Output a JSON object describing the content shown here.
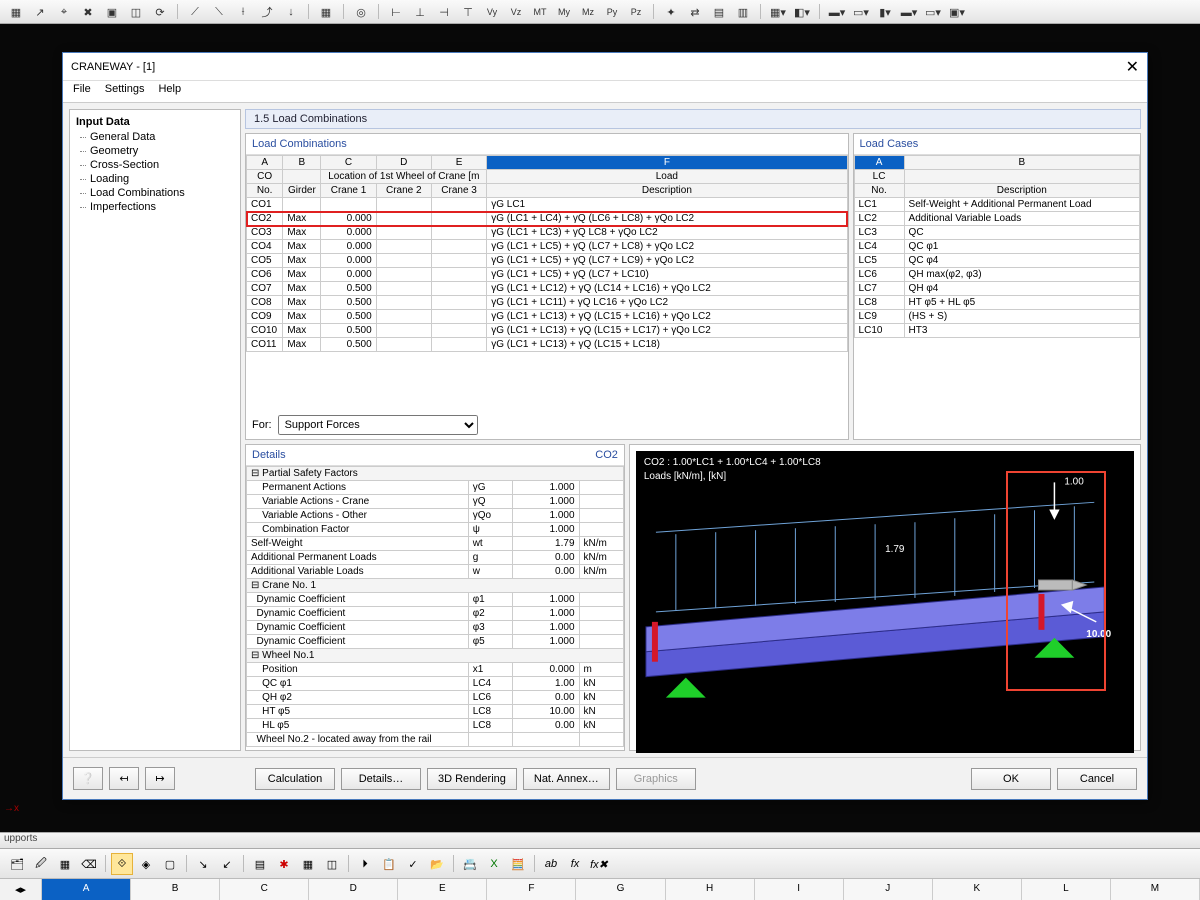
{
  "window_title": "CRANEWAY - [1]",
  "menu": [
    "File",
    "Settings",
    "Help"
  ],
  "section_title": "1.5 Load Combinations",
  "tree_root": "Input Data",
  "tree": [
    "General Data",
    "Geometry",
    "Cross-Section",
    "Loading",
    "Load Combinations",
    "Imperfections"
  ],
  "lc_panel_title": "Load Combinations",
  "lc_cols_top": [
    "A",
    "B",
    "C",
    "D",
    "E",
    "F"
  ],
  "lc_head1": {
    "a": "CO",
    "b": "",
    "c": "Location of 1st Wheel of Crane [m",
    "d": "Load"
  },
  "lc_head2": {
    "a": "No.",
    "b": "Girder",
    "c": "Crane 1",
    "d": "Crane 2",
    "e": "Crane 3",
    "f": "Description"
  },
  "lc_rows": [
    {
      "no": "CO1",
      "g": "",
      "c1": "",
      "desc": "γG LC1"
    },
    {
      "no": "CO2",
      "g": "Max",
      "c1": "0.000",
      "desc": "γG (LC1 + LC4) + γQ (LC6 + LC8) + γQo LC2",
      "hl": true
    },
    {
      "no": "CO3",
      "g": "Max",
      "c1": "0.000",
      "desc": "γG (LC1 + LC3) + γQ LC8 + γQo LC2"
    },
    {
      "no": "CO4",
      "g": "Max",
      "c1": "0.000",
      "desc": "γG (LC1 + LC5) + γQ (LC7 + LC8) + γQo LC2"
    },
    {
      "no": "CO5",
      "g": "Max",
      "c1": "0.000",
      "desc": "γG (LC1 + LC5) + γQ (LC7 + LC9) + γQo LC2"
    },
    {
      "no": "CO6",
      "g": "Max",
      "c1": "0.000",
      "desc": "γG (LC1 + LC5) + γQ (LC7 + LC10)"
    },
    {
      "no": "CO7",
      "g": "Max",
      "c1": "0.500",
      "desc": "γG (LC1 + LC12) + γQ (LC14 + LC16) + γQo LC2"
    },
    {
      "no": "CO8",
      "g": "Max",
      "c1": "0.500",
      "desc": "γG (LC1 + LC11) + γQ LC16 + γQo LC2"
    },
    {
      "no": "CO9",
      "g": "Max",
      "c1": "0.500",
      "desc": "γG (LC1 + LC13) + γQ (LC15 + LC16) + γQo LC2"
    },
    {
      "no": "CO10",
      "g": "Max",
      "c1": "0.500",
      "desc": "γG (LC1 + LC13) + γQ (LC15 + LC17) + γQo LC2"
    },
    {
      "no": "CO11",
      "g": "Max",
      "c1": "0.500",
      "desc": "γG (LC1 + LC13) + γQ (LC15 + LC18)"
    }
  ],
  "for_label": "For:",
  "for_value": "Support Forces",
  "cases_title": "Load Cases",
  "cases_cols": [
    "A",
    "B"
  ],
  "cases_head": {
    "a": "LC",
    "b": ""
  },
  "cases_head2": {
    "a": "No.",
    "b": "Description"
  },
  "cases": [
    {
      "n": "LC1",
      "d": "Self-Weight + Additional Permanent Load"
    },
    {
      "n": "LC2",
      "d": "Additional Variable Loads"
    },
    {
      "n": "LC3",
      "d": "QC"
    },
    {
      "n": "LC4",
      "d": "QC φ1"
    },
    {
      "n": "LC5",
      "d": "QC φ4"
    },
    {
      "n": "LC6",
      "d": "QH max(φ2, φ3)"
    },
    {
      "n": "LC7",
      "d": "QH φ4"
    },
    {
      "n": "LC8",
      "d": "HT φ5 + HL φ5"
    },
    {
      "n": "LC9",
      "d": "(HS + S)"
    },
    {
      "n": "LC10",
      "d": "HT3"
    }
  ],
  "details_title": "Details",
  "details_tag": "CO2",
  "details": [
    {
      "g": "Partial Safety Factors",
      "grp": true
    },
    {
      "l": "    Permanent Actions",
      "s": "γG",
      "v": "1.000",
      "u": ""
    },
    {
      "l": "    Variable Actions - Crane",
      "s": "γQ",
      "v": "1.000",
      "u": ""
    },
    {
      "l": "    Variable Actions - Other",
      "s": "γQo",
      "v": "1.000",
      "u": ""
    },
    {
      "l": "    Combination Factor",
      "s": "ψ",
      "v": "1.000",
      "u": ""
    },
    {
      "l": "Self-Weight",
      "s": "wt",
      "v": "1.79",
      "u": "kN/m"
    },
    {
      "l": "Additional Permanent Loads",
      "s": "g",
      "v": "0.00",
      "u": "kN/m"
    },
    {
      "l": "Additional Variable Loads",
      "s": "w",
      "v": "0.00",
      "u": "kN/m"
    },
    {
      "g": "Crane No. 1",
      "grp": true
    },
    {
      "l": "  Dynamic Coefficient",
      "s": "φ1",
      "v": "1.000",
      "u": ""
    },
    {
      "l": "  Dynamic Coefficient",
      "s": "φ2",
      "v": "1.000",
      "u": ""
    },
    {
      "l": "  Dynamic Coefficient",
      "s": "φ3",
      "v": "1.000",
      "u": ""
    },
    {
      "l": "  Dynamic Coefficient",
      "s": "φ5",
      "v": "1.000",
      "u": ""
    },
    {
      "g": "  Wheel No.1",
      "grp": true
    },
    {
      "l": "    Position",
      "s": "x1",
      "v": "0.000",
      "u": "m"
    },
    {
      "l": "    QC φ1",
      "s": "LC4",
      "v": "1.00",
      "u": "kN"
    },
    {
      "l": "    QH φ2",
      "s": "LC6",
      "v": "0.00",
      "u": "kN"
    },
    {
      "l": "    HT φ5",
      "s": "LC8",
      "v": "10.00",
      "u": "kN"
    },
    {
      "l": "    HL φ5",
      "s": "LC8",
      "v": "0.00",
      "u": "kN"
    },
    {
      "l": "  Wheel No.2 - located away from the rail",
      "s": "",
      "v": "",
      "u": ""
    }
  ],
  "viewer_title": "CO2 : 1.00*LC1 + 1.00*LC4 + 1.00*LC8",
  "viewer_sub": "Loads [kN/m], [kN]",
  "viewer_labels": {
    "a": "1.79",
    "b": "1.00",
    "c": "10.00"
  },
  "buttons": {
    "calc": "Calculation",
    "details": "Details…",
    "render": "3D Rendering",
    "annex": "Nat. Annex…",
    "graphics": "Graphics",
    "ok": "OK",
    "cancel": "Cancel"
  },
  "statusbar": "upports",
  "sheet_cols": [
    "A",
    "B",
    "C",
    "D",
    "E",
    "F",
    "G",
    "H",
    "I",
    "J",
    "K",
    "L",
    "M"
  ],
  "axis": "x"
}
